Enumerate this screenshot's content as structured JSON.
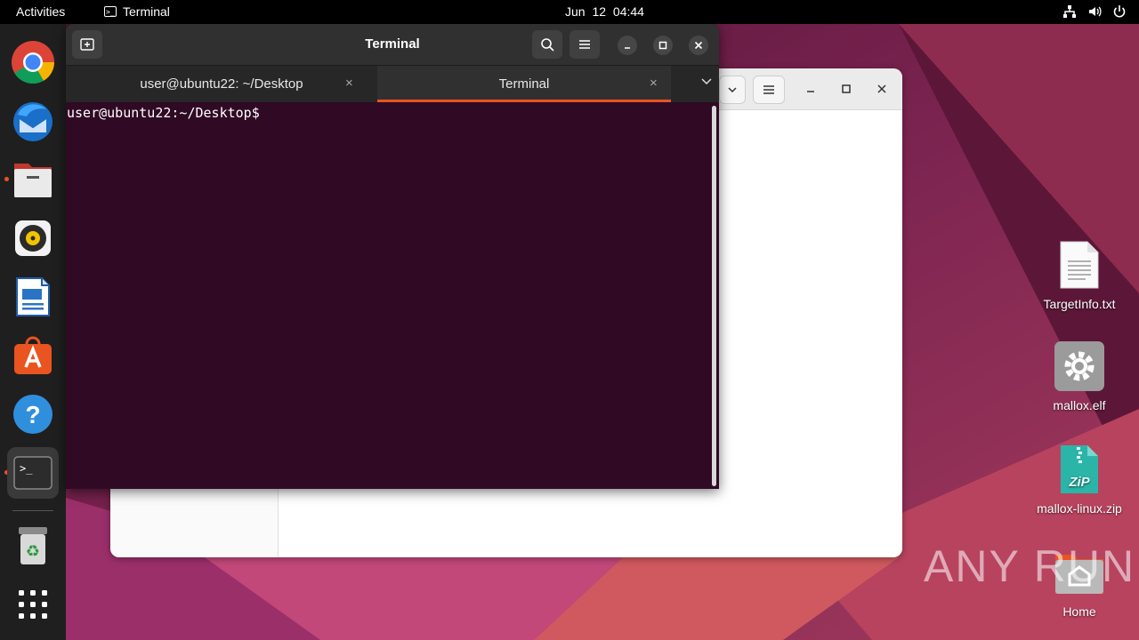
{
  "topbar": {
    "activities": "Activities",
    "app_name": "Terminal",
    "clock": "Jun 12  04:44"
  },
  "dock": {
    "items": [
      "chrome-icon",
      "thunderbird-icon",
      "files-icon",
      "rhythmbox-icon",
      "libreoffice-writer-icon",
      "app-center-icon",
      "help-icon",
      "terminal-icon",
      "trash-icon",
      "show-apps-icon"
    ]
  },
  "terminal": {
    "title": "Terminal",
    "tabs": [
      {
        "label": "user@ubuntu22: ~/Desktop",
        "close": "×"
      },
      {
        "label": "Terminal",
        "close": "×"
      }
    ],
    "prompt": "user@ubuntu22:~/Desktop$"
  },
  "desktop": {
    "icons": [
      {
        "label": "TargetInfo.txt"
      },
      {
        "label": "mallox.elf"
      },
      {
        "label": "mallox-linux.zip"
      },
      {
        "label": "Home"
      }
    ]
  },
  "watermark": "ANY RUN",
  "colors": {
    "accent": "#e95420",
    "terminal_bg": "#300a24",
    "topbar": "#000000",
    "dock": "#1f1f1f"
  }
}
